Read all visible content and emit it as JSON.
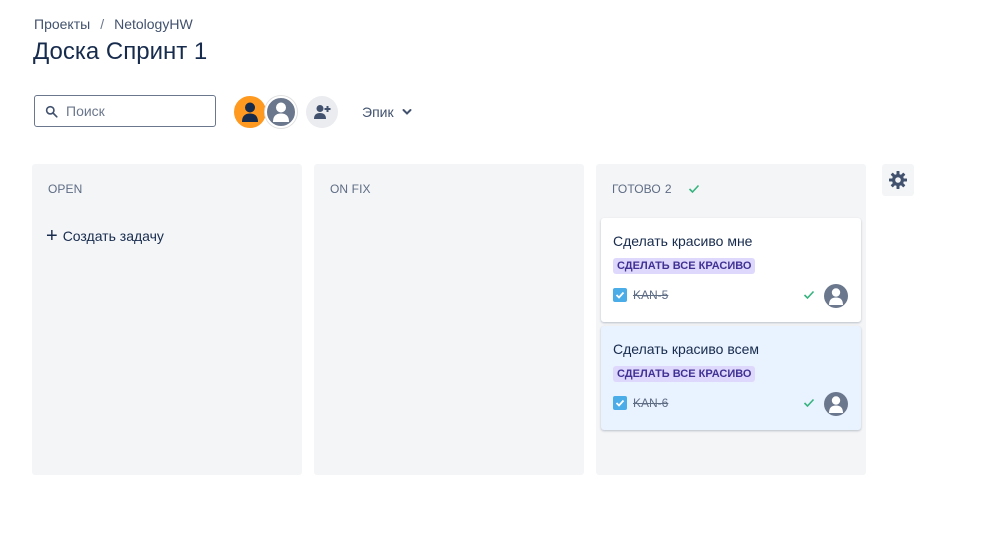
{
  "breadcrumb": {
    "projects": "Проекты",
    "separator": "/",
    "project": "NetologyHW"
  },
  "page": {
    "title": "Доска Спринт 1"
  },
  "search": {
    "placeholder": "Поиск",
    "value": ""
  },
  "toolbar": {
    "epic_label": "Эпик"
  },
  "columns": [
    {
      "name": "OPEN",
      "count": "",
      "create_label": "Создать задачу"
    },
    {
      "name": "ON FIX",
      "count": ""
    },
    {
      "name": "ГОТОВО",
      "count": "2",
      "cards": [
        {
          "title": "Сделать красиво мне",
          "epic": "СДЕЛАТЬ ВСЕ КРАСИВО",
          "key": "KAN-5",
          "done": true
        },
        {
          "title": "Сделать красиво всем",
          "epic": "СДЕЛАТЬ ВСЕ КРАСИВО",
          "key": "KAN-6",
          "done": true,
          "selected": true
        }
      ]
    }
  ],
  "colors": {
    "accent": "#0052cc",
    "avatar_orange": "#ff991f",
    "avatar_gray": "#6b778c",
    "epic_bg": "#dfd8fd",
    "epic_text": "#403294",
    "done_green": "#36b37e",
    "task_blue": "#4bade8",
    "column_bg": "#f4f5f7",
    "selected_card_bg": "#e9f2ff"
  },
  "icons": {
    "search": "search-icon",
    "avatar": "user-avatar-icon",
    "add_people": "add-people-icon",
    "chevron": "chevron-down-icon",
    "check": "check-icon",
    "task": "task-checkbox-icon",
    "settings": "gear-icon"
  }
}
